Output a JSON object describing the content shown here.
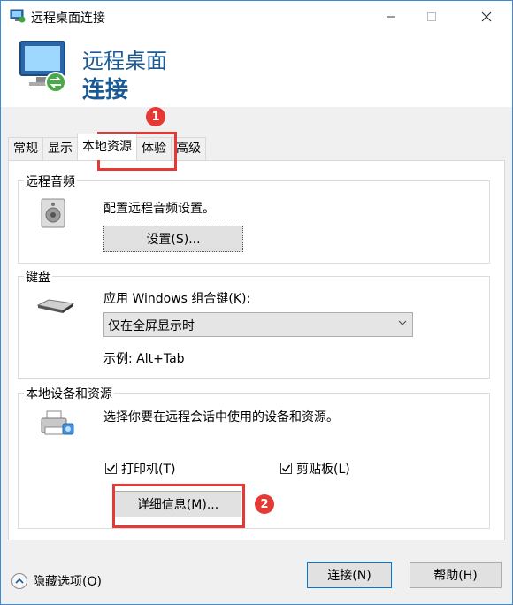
{
  "window": {
    "title": "远程桌面连接",
    "controls": {
      "minimize": "minimize",
      "maximize": "maximize",
      "close": "close"
    }
  },
  "header": {
    "line1": "远程桌面",
    "line2": "连接"
  },
  "tabs": [
    {
      "label": "常规",
      "active": false
    },
    {
      "label": "显示",
      "active": false
    },
    {
      "label": "本地资源",
      "active": true
    },
    {
      "label": "体验",
      "active": false
    },
    {
      "label": "高级",
      "active": false
    }
  ],
  "remote_audio": {
    "group_label": "远程音频",
    "description": "配置远程音频设置。",
    "settings_button": "设置(S)...",
    "icon": "speaker-icon"
  },
  "keyboard": {
    "group_label": "键盘",
    "description": "应用 Windows 组合键(K):",
    "selected_option": "仅在全屏显示时",
    "example": "示例: Alt+Tab",
    "icon": "keyboard-icon"
  },
  "local_devices": {
    "group_label": "本地设备和资源",
    "description": "选择你要在远程会话中使用的设备和资源。",
    "printer_label": "打印机(T)",
    "printer_checked": true,
    "clipboard_label": "剪贴板(L)",
    "clipboard_checked": true,
    "details_button": "详细信息(M)...",
    "icon": "printer-icon"
  },
  "annotations": {
    "badge1": "1",
    "badge2": "2",
    "color": "#e53935"
  },
  "footer": {
    "hide_options": "隐藏选项(O)",
    "connect_button": "连接(N)",
    "help_button": "帮助(H)"
  },
  "colors": {
    "accent": "#1a5a96",
    "focus": "#0078d7"
  }
}
